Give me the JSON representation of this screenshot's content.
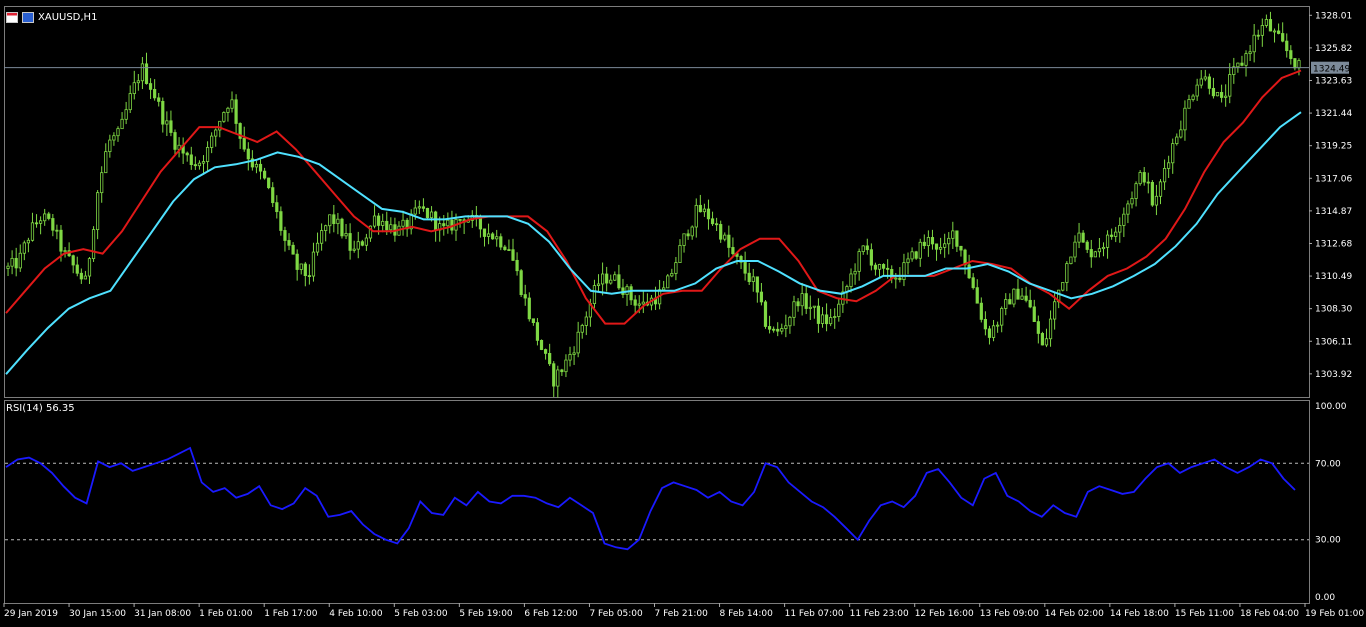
{
  "header": {
    "title": "XAUUSD,H1"
  },
  "chart_data": [
    {
      "type": "candlestick",
      "title": "XAUUSD,H1",
      "ylim": [
        1302.5,
        1328.5
      ],
      "price_ticks": [
        "1328.01",
        "1325.82",
        "1323.63",
        "1321.44",
        "1319.25",
        "1317.06",
        "1314.87",
        "1312.68",
        "1310.49",
        "1308.30",
        "1306.11",
        "1303.92"
      ],
      "current_price": "1324.49",
      "time_labels": [
        "29 Jan 2019",
        "30 Jan 15:00",
        "31 Jan 08:00",
        "1 Feb 01:00",
        "1 Feb 17:00",
        "4 Feb 10:00",
        "5 Feb 03:00",
        "5 Feb 19:00",
        "6 Feb 12:00",
        "7 Feb 05:00",
        "7 Feb 21:00",
        "8 Feb 14:00",
        "11 Feb 07:00",
        "11 Feb 23:00",
        "12 Feb 16:00",
        "13 Feb 09:00",
        "14 Feb 02:00",
        "14 Feb 18:00",
        "15 Feb 11:00",
        "18 Feb 04:00",
        "19 Feb 01:00"
      ],
      "close_path": [
        1311.0,
        1311.5,
        1313.5,
        1314.5,
        1313.8,
        1312.0,
        1311.0,
        1310.0,
        1316.0,
        1319.5,
        1320.0,
        1322.5,
        1324.5,
        1323.0,
        1321.0,
        1319.5,
        1318.5,
        1318.0,
        1319.0,
        1321.0,
        1322.5,
        1319.5,
        1318.0,
        1317.0,
        1315.0,
        1312.5,
        1311.0,
        1310.5,
        1313.0,
        1314.5,
        1313.5,
        1312.0,
        1313.0,
        1314.5,
        1314.0,
        1313.5,
        1314.0,
        1315.0,
        1314.5,
        1313.5,
        1314.0,
        1314.5,
        1314.0,
        1313.5,
        1313.0,
        1312.5,
        1310.0,
        1307.5,
        1305.5,
        1303.5,
        1304.5,
        1306.0,
        1308.0,
        1310.0,
        1310.5,
        1310.0,
        1309.0,
        1308.5,
        1309.0,
        1309.5,
        1311.5,
        1313.5,
        1315.0,
        1314.5,
        1313.5,
        1312.0,
        1311.0,
        1310.0,
        1307.5,
        1306.5,
        1307.5,
        1309.0,
        1308.5,
        1307.5,
        1307.5,
        1309.0,
        1311.0,
        1312.5,
        1311.0,
        1310.5,
        1310.5,
        1311.5,
        1312.5,
        1313.0,
        1312.0,
        1313.5,
        1311.5,
        1309.0,
        1306.5,
        1307.5,
        1309.0,
        1309.5,
        1308.0,
        1305.5,
        1308.5,
        1311.0,
        1313.5,
        1312.0,
        1312.5,
        1313.0,
        1314.5,
        1316.0,
        1317.5,
        1315.0,
        1318.0,
        1320.0,
        1322.0,
        1324.0,
        1323.5,
        1322.0,
        1324.0,
        1325.0,
        1326.5,
        1327.5,
        1326.5,
        1325.5,
        1324.5
      ],
      "series": [
        {
          "name": "",
          "color": "#e01818",
          "values": [
            1308.0,
            1309.5,
            1311.0,
            1312.0,
            1312.3,
            1312.0,
            1313.5,
            1315.5,
            1317.5,
            1319.0,
            1320.5,
            1320.5,
            1320.0,
            1319.5,
            1320.2,
            1319.0,
            1317.5,
            1316.0,
            1314.5,
            1313.5,
            1313.5,
            1313.8,
            1313.5,
            1313.8,
            1314.3,
            1314.5,
            1314.5,
            1314.5,
            1313.5,
            1311.5,
            1309.0,
            1307.3,
            1307.3,
            1308.5,
            1309.3,
            1309.5,
            1309.5,
            1311.0,
            1312.3,
            1313.0,
            1313.0,
            1311.5,
            1309.5,
            1309.0,
            1308.8,
            1309.5,
            1310.5,
            1310.5,
            1310.5,
            1311.0,
            1311.5,
            1311.3,
            1311.0,
            1310.0,
            1309.3,
            1308.3,
            1309.5,
            1310.5,
            1311.0,
            1311.8,
            1313.0,
            1315.0,
            1317.5,
            1319.5,
            1320.8,
            1322.5,
            1323.8,
            1324.3
          ]
        },
        {
          "name": "",
          "color": "#4fe1ff",
          "values": [
            1303.9,
            1305.5,
            1307.0,
            1308.3,
            1309.0,
            1309.5,
            1311.5,
            1313.5,
            1315.5,
            1317.0,
            1317.8,
            1318.0,
            1318.3,
            1318.8,
            1318.5,
            1318.0,
            1317.0,
            1316.0,
            1315.0,
            1314.8,
            1314.3,
            1314.3,
            1314.5,
            1314.5,
            1314.5,
            1314.0,
            1312.8,
            1311.0,
            1309.5,
            1309.3,
            1309.5,
            1309.5,
            1309.5,
            1310.0,
            1311.0,
            1311.5,
            1311.5,
            1310.8,
            1310.0,
            1309.5,
            1309.3,
            1309.8,
            1310.5,
            1310.5,
            1310.5,
            1311.0,
            1311.0,
            1311.3,
            1310.8,
            1310.0,
            1309.5,
            1309.0,
            1309.3,
            1309.8,
            1310.5,
            1311.3,
            1312.5,
            1314.0,
            1316.0,
            1317.5,
            1319.0,
            1320.5,
            1321.5
          ]
        }
      ],
      "grid": false
    },
    {
      "type": "line",
      "title": "RSI(14) 56.35",
      "ylim": [
        0,
        100
      ],
      "ticks": [
        "100.00",
        "70.00",
        "30.00",
        "0.00"
      ],
      "levels": [
        70,
        30
      ],
      "series": [
        {
          "name": "RSI(14)",
          "color": "#1a1aff",
          "values": [
            68,
            72,
            73,
            70,
            65,
            58,
            52,
            49,
            71,
            68,
            70,
            66,
            68,
            70,
            72,
            75,
            78,
            60,
            55,
            57,
            52,
            54,
            58,
            48,
            46,
            49,
            57,
            53,
            42,
            43,
            45,
            38,
            33,
            30,
            28,
            36,
            50,
            44,
            43,
            52,
            48,
            55,
            50,
            49,
            53,
            53,
            52,
            49,
            47,
            52,
            48,
            44,
            28,
            26,
            25,
            30,
            45,
            57,
            60,
            58,
            56,
            52,
            55,
            50,
            48,
            55,
            70,
            68,
            60,
            55,
            50,
            47,
            42,
            36,
            30,
            40,
            48,
            50,
            47,
            53,
            65,
            67,
            60,
            52,
            48,
            62,
            65,
            53,
            50,
            45,
            42,
            48,
            44,
            42,
            55,
            58,
            56,
            54,
            55,
            62,
            68,
            70,
            65,
            68,
            70,
            72,
            68,
            65,
            68,
            72,
            70,
            62,
            56
          ]
        }
      ],
      "grid": false
    }
  ]
}
